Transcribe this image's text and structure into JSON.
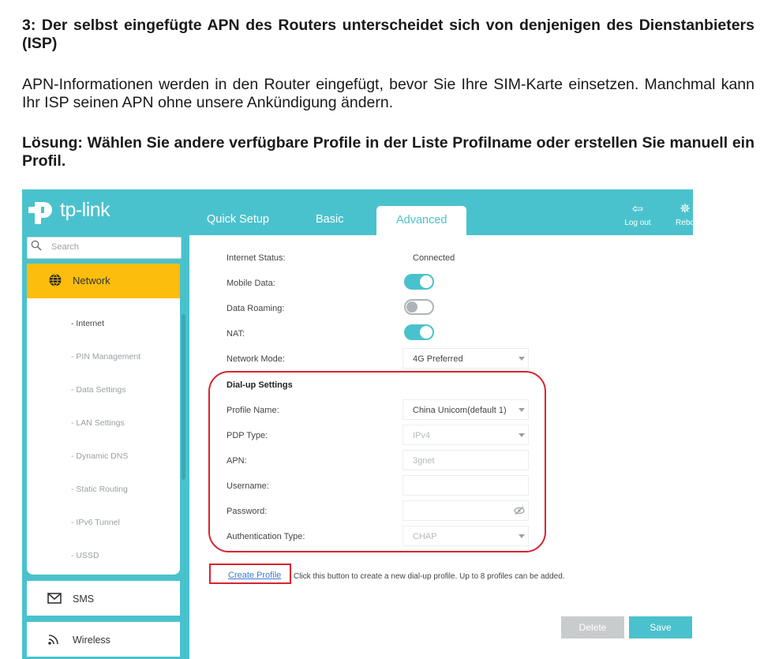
{
  "document": {
    "heading": "3: Der selbst eingefügte APN des Routers unterscheidet sich von denjenigen des Dienstanbieters (ISP)",
    "paragraph": "APN-Informationen werden in den Router eingefügt, bevor Sie Ihre SIM-Karte einsetzen. Manchmal kann Ihr ISP seinen APN ohne unsere Ankündigung ändern.",
    "solution": "Lösung: Wählen Sie andere verfügbare Profile in der Liste Profilname oder erstellen Sie manuell ein Profil."
  },
  "router": {
    "logo_text": "tp-link",
    "tabs": [
      {
        "label": "Quick Setup",
        "active": false
      },
      {
        "label": "Basic",
        "active": false
      },
      {
        "label": "Advanced",
        "active": true
      }
    ],
    "header_actions": [
      {
        "label": "Log out",
        "icon": "logout-icon"
      },
      {
        "label": "Rebo",
        "icon": "reboot-icon"
      }
    ],
    "search_placeholder": "Search",
    "sidebar": {
      "active_section": "Network",
      "sub_items": [
        "- Internet",
        "- PIN Management",
        "- Data Settings",
        "- LAN Settings",
        "- Dynamic DNS",
        "- Static Routing",
        "- IPv6 Tunnel",
        "- USSD"
      ],
      "current_sub_item": "- Internet",
      "other_sections": [
        "SMS",
        "Wireless"
      ]
    },
    "form": {
      "internet_status_label": "Internet Status:",
      "internet_status_value": "Connected",
      "mobile_data_label": "Mobile Data:",
      "mobile_data_on": true,
      "data_roaming_label": "Data Roaming:",
      "data_roaming_on": false,
      "nat_label": "NAT:",
      "nat_on": true,
      "network_mode_label": "Network Mode:",
      "network_mode_value": "4G Preferred",
      "dialup_title": "Dial-up Settings",
      "profile_name_label": "Profile Name:",
      "profile_name_value": "China Unicom(default 1)",
      "pdp_type_label": "PDP Type:",
      "pdp_type_value": "IPv4",
      "apn_label": "APN:",
      "apn_value": "3gnet",
      "username_label": "Username:",
      "password_label": "Password:",
      "auth_type_label": "Authentication Type:",
      "auth_type_value": "CHAP",
      "create_profile": "Create Profile",
      "create_help": "Click this button to create a new dial-up profile. Up to 8 profiles can be added.",
      "delete_label": "Delete",
      "save_label": "Save"
    },
    "colors": {
      "brand_teal": "#4ac2cd",
      "active_nav": "#fdbd0c",
      "highlight_red": "#d8242f"
    }
  }
}
